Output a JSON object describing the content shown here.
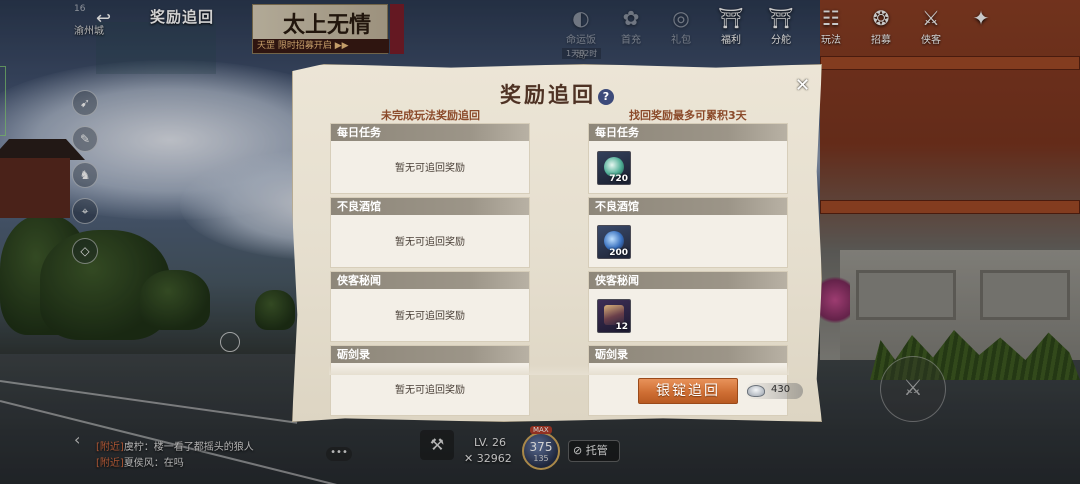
{
  "hud": {
    "status_time": "16",
    "page_name": "奖励追回",
    "zone": "渝州城",
    "banner": {
      "logo": "太上无情",
      "tag": "天罡 限时招募开启 ▶▶"
    },
    "top_icons": [
      {
        "key": "event",
        "label": "命运饭局",
        "icon": "fan-icon",
        "glyph": "◐",
        "dim": true
      },
      {
        "key": "rank",
        "label": "首充",
        "icon": "flower-icon",
        "glyph": "✿",
        "dim": true
      },
      {
        "key": "gift",
        "label": "礼包",
        "icon": "gift-icon",
        "glyph": "◎",
        "dim": true
      },
      {
        "key": "welfare",
        "label": "福利",
        "icon": "shrine-icon",
        "glyph": "⛩",
        "dim": false
      },
      {
        "key": "shop",
        "label": "分舵",
        "icon": "gate-icon",
        "glyph": "⛩",
        "dim": false
      },
      {
        "key": "play",
        "label": "玩法",
        "icon": "table-icon",
        "glyph": "☷",
        "dim": false
      },
      {
        "key": "recruit",
        "label": "招募",
        "icon": "recruit-icon",
        "glyph": "❂",
        "dim": false
      },
      {
        "key": "hero",
        "label": "侠客",
        "icon": "sword-icon",
        "glyph": "⚔",
        "dim": false
      },
      {
        "key": "more",
        "label": "",
        "icon": "shuriken-icon",
        "glyph": "✦",
        "dim": false
      }
    ],
    "timer_chip": "1天02时",
    "chat": [
      {
        "tag": "[附近]",
        "name": "虞柠",
        "text": "：楼一看了都摇头的狼人"
      },
      {
        "tag": "[附近]",
        "name": "夏侯风",
        "text": "：在吗"
      }
    ],
    "level": "LV. 26",
    "power": "32962",
    "orb": {
      "max": "MAX",
      "value": "375",
      "sub": "135"
    },
    "auto_label": "托管"
  },
  "dialog": {
    "title": "奖励追回",
    "help_icon": "?",
    "close_icon": "✕",
    "left_header": "未完成玩法奖励追回",
    "right_header": "找回奖励最多可累积3天",
    "empty_text": "暂无可追回奖励",
    "left_cards": [
      {
        "name": "每日任务"
      },
      {
        "name": "不良酒馆"
      },
      {
        "name": "侠客秘闻"
      },
      {
        "name": "砺剑录"
      }
    ],
    "right_cards": [
      {
        "name": "每日任务",
        "item": "jade-orb-icon",
        "qty": "720"
      },
      {
        "name": "不良酒馆",
        "item": "scroll-icon",
        "qty": "200"
      },
      {
        "name": "侠客秘闻",
        "item": "hero-portrait-icon",
        "qty": "12"
      },
      {
        "name": "砺剑录",
        "item": "",
        "qty": ""
      }
    ],
    "recover_button": "银锭追回",
    "currency": {
      "icon": "silver-ingot-icon",
      "value": "430"
    }
  },
  "colors": {
    "title": "#4e3224",
    "header_accent": "#8b4a2a",
    "button": "#cf6f34",
    "card_header": "#8e877a",
    "paper": "#e6dfcf"
  }
}
